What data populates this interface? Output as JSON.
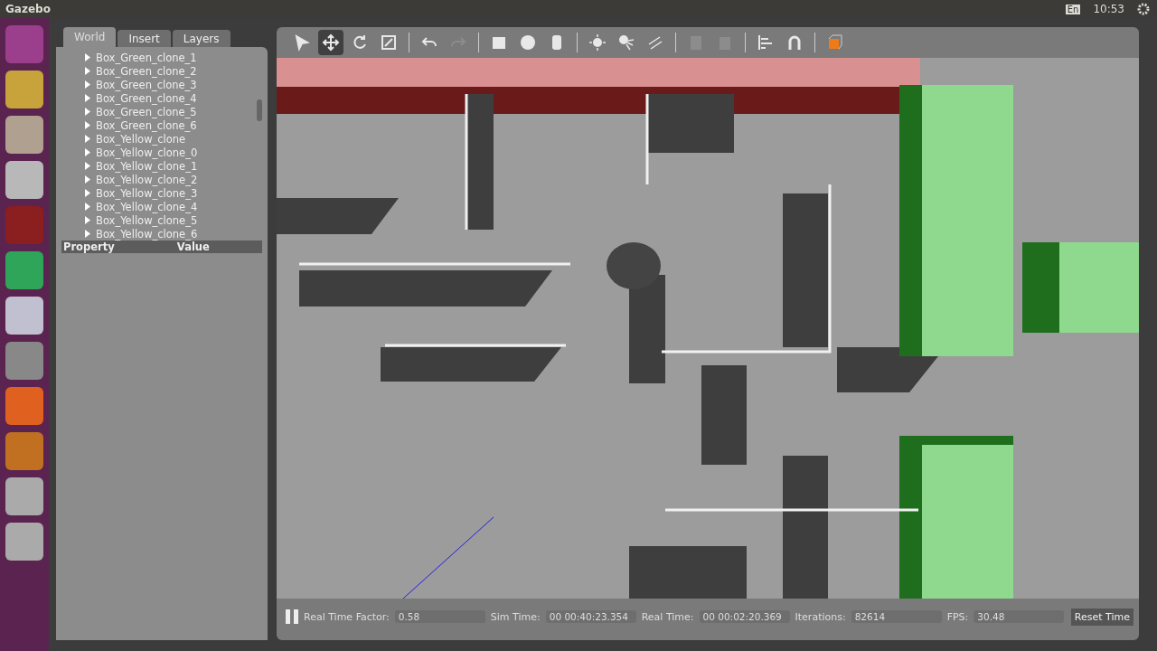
{
  "topbar": {
    "title": "Gazebo",
    "keyboard": "En",
    "time": "10:53"
  },
  "tabs": [
    {
      "label": "World",
      "selected": true
    },
    {
      "label": "Insert",
      "selected": false
    },
    {
      "label": "Layers",
      "selected": false
    }
  ],
  "tree": {
    "items": [
      "Box_Green_clone_1",
      "Box_Green_clone_2",
      "Box_Green_clone_3",
      "Box_Green_clone_4",
      "Box_Green_clone_5",
      "Box_Green_clone_6",
      "Box_Yellow_clone",
      "Box_Yellow_clone_0",
      "Box_Yellow_clone_1",
      "Box_Yellow_clone_2",
      "Box_Yellow_clone_3",
      "Box_Yellow_clone_4",
      "Box_Yellow_clone_5",
      "Box_Yellow_clone_6"
    ]
  },
  "properties": {
    "columns": [
      "Property",
      "Value"
    ]
  },
  "toolbar": {
    "tools": [
      {
        "kind": "select",
        "selected": false,
        "disabled": false
      },
      {
        "kind": "translate",
        "selected": true,
        "disabled": false
      },
      {
        "kind": "rotate",
        "selected": false,
        "disabled": false
      },
      {
        "kind": "scale",
        "selected": false,
        "disabled": false
      },
      {
        "kind": "undo",
        "selected": false,
        "disabled": false
      },
      {
        "kind": "redo",
        "selected": false,
        "disabled": true
      },
      {
        "kind": "box",
        "selected": false,
        "disabled": false
      },
      {
        "kind": "sphere",
        "selected": false,
        "disabled": false
      },
      {
        "kind": "cylinder",
        "selected": false,
        "disabled": false
      },
      {
        "kind": "pointlight",
        "selected": false,
        "disabled": false
      },
      {
        "kind": "spotlight",
        "selected": false,
        "disabled": false
      },
      {
        "kind": "dirlight",
        "selected": false,
        "disabled": false
      },
      {
        "kind": "copy",
        "selected": false,
        "disabled": true
      },
      {
        "kind": "paste",
        "selected": false,
        "disabled": true
      },
      {
        "kind": "align",
        "selected": false,
        "disabled": false
      },
      {
        "kind": "snap",
        "selected": false,
        "disabled": false
      },
      {
        "kind": "view",
        "selected": false,
        "disabled": false
      }
    ]
  },
  "status_bar": {
    "fields": [
      {
        "label": "Real Time Factor:",
        "value": "0.58"
      },
      {
        "label": "Sim Time:",
        "value": "00 00:40:23.354"
      },
      {
        "label": "Real Time:",
        "value": "00 00:02:20.369"
      },
      {
        "label": "Iterations:",
        "value": "82614"
      },
      {
        "label": "FPS:",
        "value": "30.48"
      }
    ],
    "button": "Reset Time"
  }
}
